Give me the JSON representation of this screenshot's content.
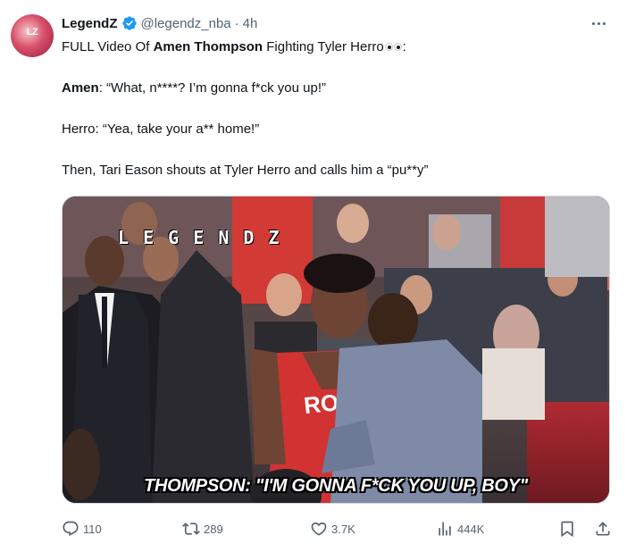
{
  "author": {
    "avatar_text": "LZ",
    "name": "LegendZ",
    "handle": "@legendz_nba",
    "separator": "·",
    "time": "4h"
  },
  "tweet": {
    "line1_pre": "FULL Video Of ",
    "line1_bold": "Amen Thompson",
    "line1_post": " Fighting Tyler Herro",
    "line1_end": ":",
    "line2_bold": "Amen",
    "line2_rest": ": “What, n****? I’m gonna f*ck you up!”",
    "line3": "Herro: “Yea, take your a** home!”",
    "line4": "Then, Tari Eason shouts at Tyler Herro and calls him a “pu**y”"
  },
  "media": {
    "watermark": "L E G E N D Z",
    "caption": "THOMPSON: \"I'M GONNA F*CK YOU UP, BOY\""
  },
  "actions": {
    "replies": "110",
    "retweets": "289",
    "likes": "3.7K",
    "views": "444K"
  },
  "icons": {
    "verified": "verified-badge-icon",
    "more": "more-options-icon",
    "reply": "reply-icon",
    "retweet": "retweet-icon",
    "like": "heart-icon",
    "views": "views-chart-icon",
    "bookmark": "bookmark-icon",
    "share": "share-icon"
  },
  "colors": {
    "text_primary": "#0f1419",
    "text_secondary": "#536471",
    "verified_blue": "#1d9bf0",
    "border": "#cfd9de"
  }
}
